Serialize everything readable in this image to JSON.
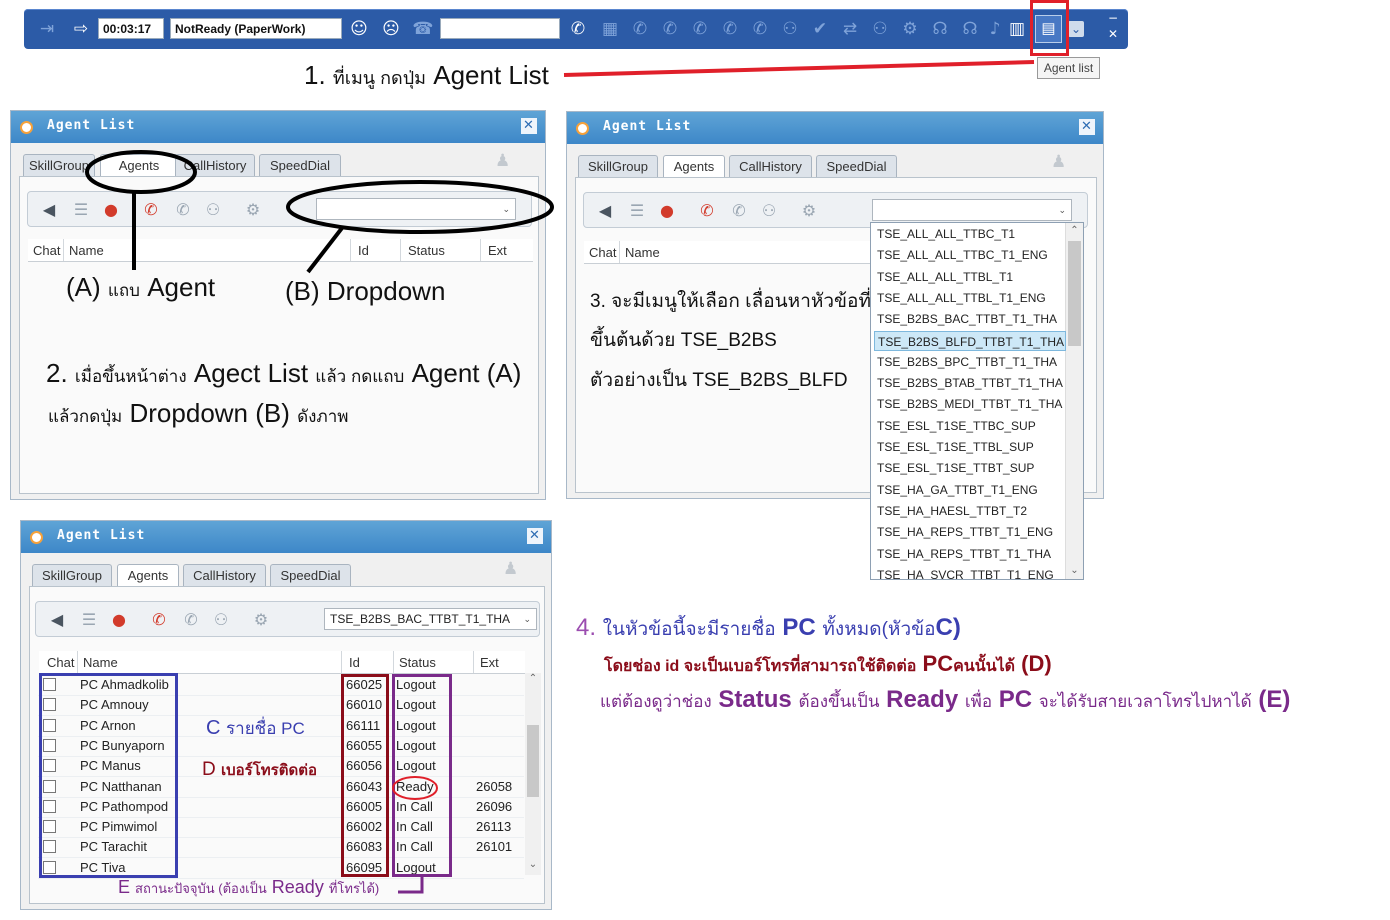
{
  "toolbar": {
    "timer": "00:03:17",
    "status": "NotReady (PaperWork)",
    "phone_input": "",
    "tooltip": "Agent list"
  },
  "panel_title": "Agent  List",
  "tabs": [
    "SkillGroup",
    "Agents",
    "CallHistory",
    "SpeedDial"
  ],
  "columns": {
    "chat": "Chat",
    "name": "Name",
    "id": "Id",
    "status": "Status",
    "ext": "Ext"
  },
  "dropdown_list": [
    "TSE_ALL_ALL_TTBC_T1",
    "TSE_ALL_ALL_TTBC_T1_ENG",
    "TSE_ALL_ALL_TTBL_T1",
    "TSE_ALL_ALL_TTBL_T1_ENG",
    "TSE_B2BS_BAC_TTBT_T1_THA",
    "TSE_B2BS_BLFD_TTBT_T1_THA",
    "TSE_B2BS_BPC_TTBT_T1_THA",
    "TSE_B2BS_BTAB_TTBT_T1_THA",
    "TSE_B2BS_MEDI_TTBT_T1_THA",
    "TSE_ESL_T1SE_TTBC_SUP",
    "TSE_ESL_T1SE_TTBL_SUP",
    "TSE_ESL_T1SE_TTBT_SUP",
    "TSE_HA_GA_TTBT_T1_ENG",
    "TSE_HA_HAESL_TTBT_T2",
    "TSE_HA_REPS_TTBT_T1_ENG",
    "TSE_HA_REPS_TTBT_T1_THA",
    "TSE_HA_SVCR_TTBT_T1_ENG"
  ],
  "selected_dropdown": "TSE_B2BS_BAC_TTBT_T1_THA",
  "agents": [
    {
      "name": "PC Ahmadkolib",
      "id": "66025",
      "status": "Logout",
      "ext": ""
    },
    {
      "name": "PC Amnouy",
      "id": "66010",
      "status": "Logout",
      "ext": ""
    },
    {
      "name": "PC Arnon",
      "id": "66111",
      "status": "Logout",
      "ext": ""
    },
    {
      "name": "PC Bunyaporn",
      "id": "66055",
      "status": "Logout",
      "ext": ""
    },
    {
      "name": "PC Manus",
      "id": "66056",
      "status": "Logout",
      "ext": ""
    },
    {
      "name": "PC Natthanan",
      "id": "66043",
      "status": "Ready",
      "ext": "26058"
    },
    {
      "name": "PC Pathompod",
      "id": "66005",
      "status": "In Call",
      "ext": "26096"
    },
    {
      "name": "PC Pimwimol",
      "id": "66002",
      "status": "In Call",
      "ext": "26113"
    },
    {
      "name": "PC Tarachit",
      "id": "66083",
      "status": "In Call",
      "ext": "26101"
    },
    {
      "name": "PC Tiva",
      "id": "66095",
      "status": "Logout",
      "ext": ""
    }
  ],
  "annotations": {
    "step1_num": "1.",
    "step1_th": "ที่เมนู กดปุ่ม",
    "step1_en": "Agent List",
    "a_label": "(A)",
    "a_th": "แถบ",
    "a_en": "Agent",
    "b_label": "(B)",
    "b_en": "Dropdown",
    "step2_line1_num": "2.",
    "step2_line1_th": "เมื่อขึ้นหน้าต่าง",
    "step2_line1_en": "Agect List",
    "step2_line1_th2": "แล้ว กดแถบ",
    "step2_line1_en2": "Agent (A)",
    "step2_line2_th": "แล้วกดปุ่ม",
    "step2_line2_en": "Dropdown (B)",
    "step2_line2_th2": "ดังภาพ",
    "step3_line1": "3. จะมีเมนูให้เลือก เลื่อนหาหัวข้อที่",
    "step3_line2": "ขึ้นต้นด้วย TSE_B2BS",
    "step3_line3": "ตัวอย่างเป็น TSE_B2BS_BLFD",
    "c_label": "C",
    "c_text": "รายชื่อ PC",
    "d_label": "D",
    "d_text": "เบอร์โทรติดต่อ",
    "e_label": "E",
    "e_th": "สถานะปัจจุบัน (ต้องเป็น",
    "e_en": "Ready",
    "e_th2": "ที่โทรได้)",
    "step4_num": "4.",
    "step4_a": "ในหัวข้อนี้จะมีรายชื่อ",
    "step4_b": "PC",
    "step4_c": "ทั้งหมด(หัวข้อ",
    "step4_d": "C)",
    "step4_l2_a": "โดยช่อง id จะเป็นเบอร์โทรที่สามารถใช้ติดต่อ",
    "step4_l2_b": "PC",
    "step4_l2_c": "คนนั้นได้",
    "step4_l2_d": "(D)",
    "step4_l3_a": "แต่ต้องดูว่าช่อง",
    "step4_l3_b": "Status",
    "step4_l3_c": "ต้องขึ้นเป็น",
    "step4_l3_d": "Ready",
    "step4_l3_e": "เพื่อ",
    "step4_l3_f": "PC",
    "step4_l3_g": "จะได้รับสายเวลาโทรไปหาได้",
    "step4_l3_h": "(E)"
  },
  "colors": {
    "toolbar": "#2c5ba7",
    "title_bar": "#3d87c8",
    "highlight_red": "#e0202a",
    "blue_annot": "#3a3fb0",
    "darkred_annot": "#8b0d1a",
    "purple_annot": "#7a2a8a"
  }
}
